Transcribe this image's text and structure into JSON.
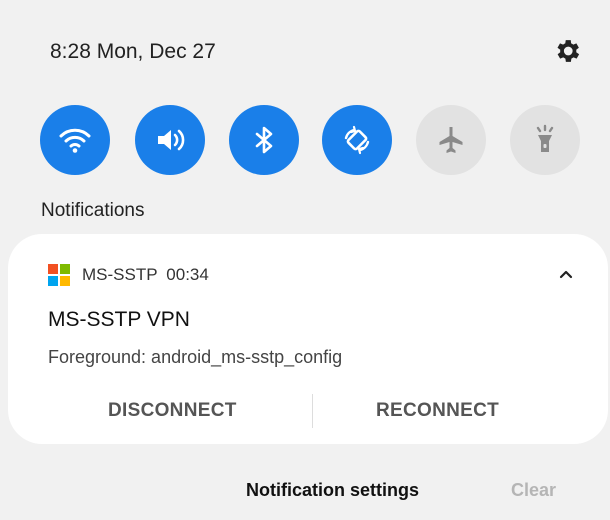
{
  "status": {
    "time_date": "8:28 Mon, Dec 27"
  },
  "quick_settings": {
    "tiles": [
      {
        "name": "wifi",
        "icon": "wifi-icon",
        "active": true
      },
      {
        "name": "sound",
        "icon": "volume-icon",
        "active": true
      },
      {
        "name": "bluetooth",
        "icon": "bluetooth-icon",
        "active": true
      },
      {
        "name": "auto-rotate",
        "icon": "rotate-icon",
        "active": true
      },
      {
        "name": "airplane-mode",
        "icon": "airplane-icon",
        "active": false
      },
      {
        "name": "flashlight",
        "icon": "flashlight-icon",
        "active": false
      }
    ],
    "accent_color": "#1a7fe9",
    "inactive_color": "#e2e2e2"
  },
  "notifications": {
    "heading": "Notifications",
    "items": [
      {
        "app_name": "MS-SSTP",
        "time": "00:34",
        "title": "MS-SSTP VPN",
        "text": "Foreground: android_ms-sstp_config",
        "actions": [
          "DISCONNECT",
          "RECONNECT"
        ]
      }
    ]
  },
  "footer": {
    "settings_label": "Notification settings",
    "clear_label": "Clear"
  }
}
